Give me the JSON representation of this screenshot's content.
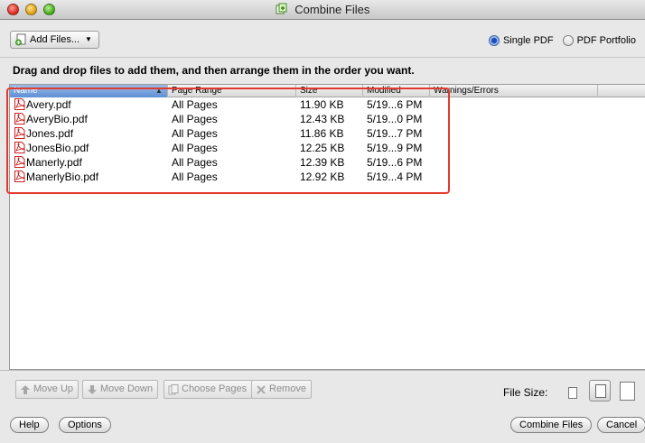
{
  "window": {
    "title": "Combine Files"
  },
  "toolbar": {
    "add_files_label": "Add Files...",
    "output_options": [
      {
        "label": "Single PDF",
        "selected": true
      },
      {
        "label": "PDF Portfolio",
        "selected": false
      }
    ]
  },
  "instruction": "Drag and drop files to add them, and then arrange them in the order you want.",
  "table": {
    "columns": [
      "Name",
      "Page Range",
      "Size",
      "Modified",
      "Warnings/Errors"
    ],
    "sorted_by": "Name",
    "rows": [
      {
        "name": "Avery.pdf",
        "page_range": "All Pages",
        "size": "11.90 KB",
        "modified": "5/19...6 PM",
        "warnings": ""
      },
      {
        "name": "AveryBio.pdf",
        "page_range": "All Pages",
        "size": "12.43 KB",
        "modified": "5/19...0 PM",
        "warnings": ""
      },
      {
        "name": "Jones.pdf",
        "page_range": "All Pages",
        "size": "11.86 KB",
        "modified": "5/19...7 PM",
        "warnings": ""
      },
      {
        "name": "JonesBio.pdf",
        "page_range": "All Pages",
        "size": "12.25 KB",
        "modified": "5/19...9 PM",
        "warnings": ""
      },
      {
        "name": "Manerly.pdf",
        "page_range": "All Pages",
        "size": "12.39 KB",
        "modified": "5/19...6 PM",
        "warnings": ""
      },
      {
        "name": "ManerlyBio.pdf",
        "page_range": "All Pages",
        "size": "12.92 KB",
        "modified": "5/19...4 PM",
        "warnings": ""
      }
    ]
  },
  "tools": {
    "move_up": "Move Up",
    "move_down": "Move Down",
    "choose_pages": "Choose Pages",
    "remove": "Remove"
  },
  "file_size_label": "File Size:",
  "footer": {
    "help": "Help",
    "options": "Options",
    "combine": "Combine Files",
    "cancel": "Cancel"
  },
  "colors": {
    "highlight": "#e23a2e",
    "selected_header": "#5f8fd6",
    "pdf_icon": "#cc1f1f"
  }
}
